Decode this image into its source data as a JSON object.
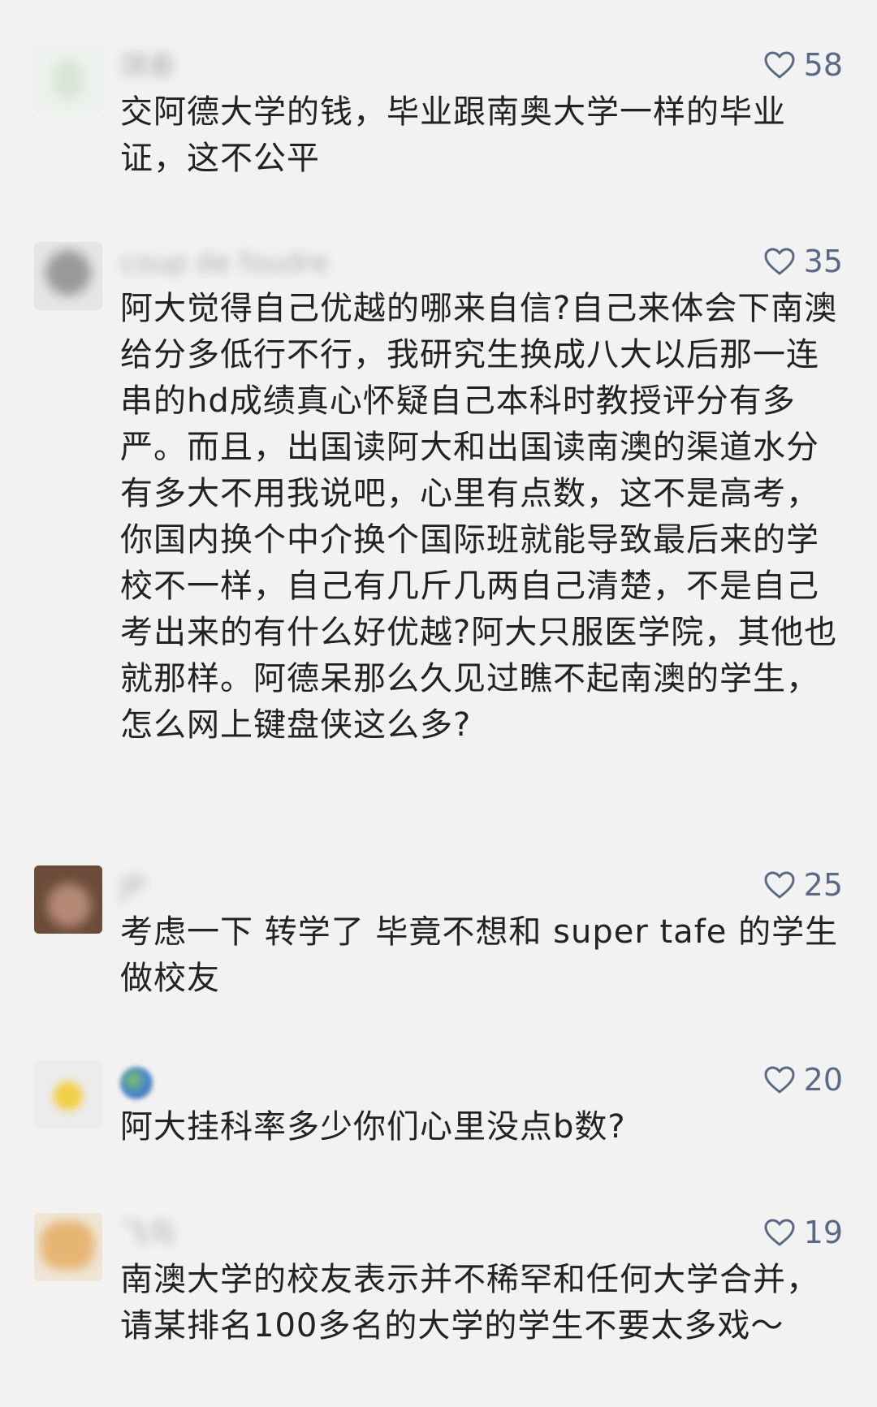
{
  "comments": [
    {
      "username": "琪泰",
      "likes": "58",
      "text": "交阿德大学的钱，毕业跟南奥大学一样的毕业证，这不公平"
    },
    {
      "username": "coup de foudre",
      "likes": "35",
      "text": "阿大觉得自己优越的哪来自信?自己来体会下南澳给分多低行不行，我研究生换成八大以后那一连串的hd成绩真心怀疑自己本科时教授评分有多严。而且，出国读阿大和出国读南澳的渠道水分有多大不用我说吧，心里有点数，这不是高考，你国内换个中介换个国际班就能导致最后来的学校不一样，自己有几斤几两自己清楚，不是自己考出来的有什么好优越?阿大只服医学院，其他也就那样。阿德呆那么久见过瞧不起南澳的学生，怎么网上键盘侠这么多?"
    },
    {
      "username": "JP",
      "likes": "25",
      "text": "考虑一下 转学了 毕竟不想和 super tafe 的学生做校友"
    },
    {
      "username": "",
      "likes": "20",
      "text": "阿大挂科率多少你们心里没点b数?"
    },
    {
      "username": "飞鸟",
      "likes": "19",
      "text": "南澳大学的校友表示并不稀罕和任何大学合并，请某排名100多名的大学的学生不要太多戏～"
    }
  ],
  "icons": {
    "like": "heart-outline-icon"
  },
  "colors": {
    "like_accent": "#5a6a85",
    "background": "#f2f2f2",
    "text": "#222222"
  }
}
